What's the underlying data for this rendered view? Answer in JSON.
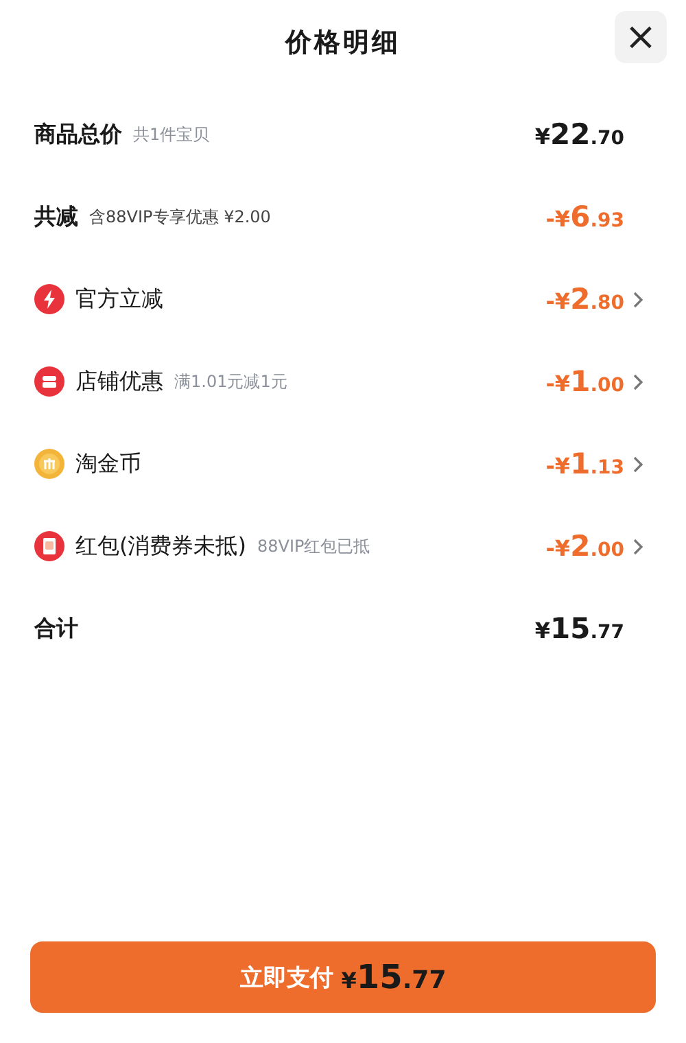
{
  "header": {
    "title": "价格明细",
    "close": "×"
  },
  "rows": [
    {
      "kind": "summary",
      "label": "商品总价",
      "note": "共1件宝贝",
      "amount": "¥22.70"
    },
    {
      "kind": "discount",
      "label": "共减",
      "note": "含88VIP专享优惠 ¥2.00",
      "amount": "-¥6.93"
    },
    {
      "kind": "benefit",
      "label": "官方立减",
      "amount": "-¥2.80"
    },
    {
      "kind": "benefit",
      "label": "店铺优惠",
      "note": "满1.01元减1元",
      "amount": "-¥1.00"
    },
    {
      "kind": "benefit",
      "label": "淘金币",
      "amount": "-¥1.13"
    },
    {
      "kind": "benefit",
      "label": "红包(消费券未抵)",
      "note": "88VIP红包已抵",
      "amount": "-¥2.00"
    },
    {
      "kind": "summary",
      "label": "合计",
      "amount": "¥15.77"
    }
  ],
  "pay_button": {
    "label": "立即支付",
    "amount": "¥15.77"
  }
}
